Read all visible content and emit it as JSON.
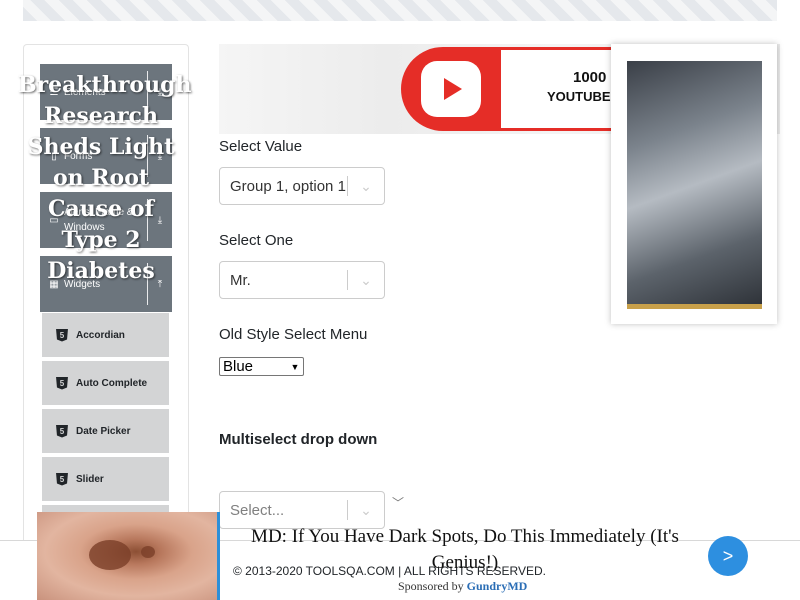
{
  "sidebar": {
    "groups": [
      {
        "label": "Elements",
        "icon": "list-icon",
        "arrow": "download-icon"
      },
      {
        "label": "Forms",
        "icon": "document-icon",
        "arrow": "download-icon"
      },
      {
        "label": "Alerts, Frame & Windows",
        "icon": "window-icon",
        "arrow": "download-icon"
      },
      {
        "label": "Widgets",
        "icon": "grid-icon",
        "arrow": "upload-icon"
      }
    ],
    "widget_items": [
      {
        "label": "Accordian",
        "icon": "html5-icon"
      },
      {
        "label": "Auto Complete",
        "icon": "html5-icon"
      },
      {
        "label": "Date Picker",
        "icon": "html5-icon"
      },
      {
        "label": "Slider",
        "icon": "html5-icon"
      }
    ]
  },
  "banner": {
    "count_text": "1000",
    "sub_text": "YOUTUBE V"
  },
  "form": {
    "select_value": {
      "label": "Select Value",
      "value": "Group 1, option 1"
    },
    "select_one": {
      "label": "Select One",
      "value": "Mr."
    },
    "old_style": {
      "label": "Old Style Select Menu",
      "value": "Blue"
    },
    "multiselect": {
      "label": "Multiselect drop down",
      "placeholder": "Select..."
    }
  },
  "side_ad": {
    "title": "Breakthrough Research Sheds Light on Root Cause of Type 2 Diabetes"
  },
  "footer": {
    "copyright": "© 2013-2020 TOOLSQA.COM | ALL RIGHTS RESERVED."
  },
  "bottom_ad": {
    "headline": "MD: If You Have Dark Spots, Do This Immediately (It's Genius!)",
    "sponsored_prefix": "Sponsored by",
    "sponsor": "GundryMD",
    "next_label": ">"
  },
  "colors": {
    "sidebar_group": "#6c757d",
    "sidebar_sub": "#d3d4d5",
    "ad_next": "#2d8fe0",
    "youtube_red": "#e52d27"
  }
}
